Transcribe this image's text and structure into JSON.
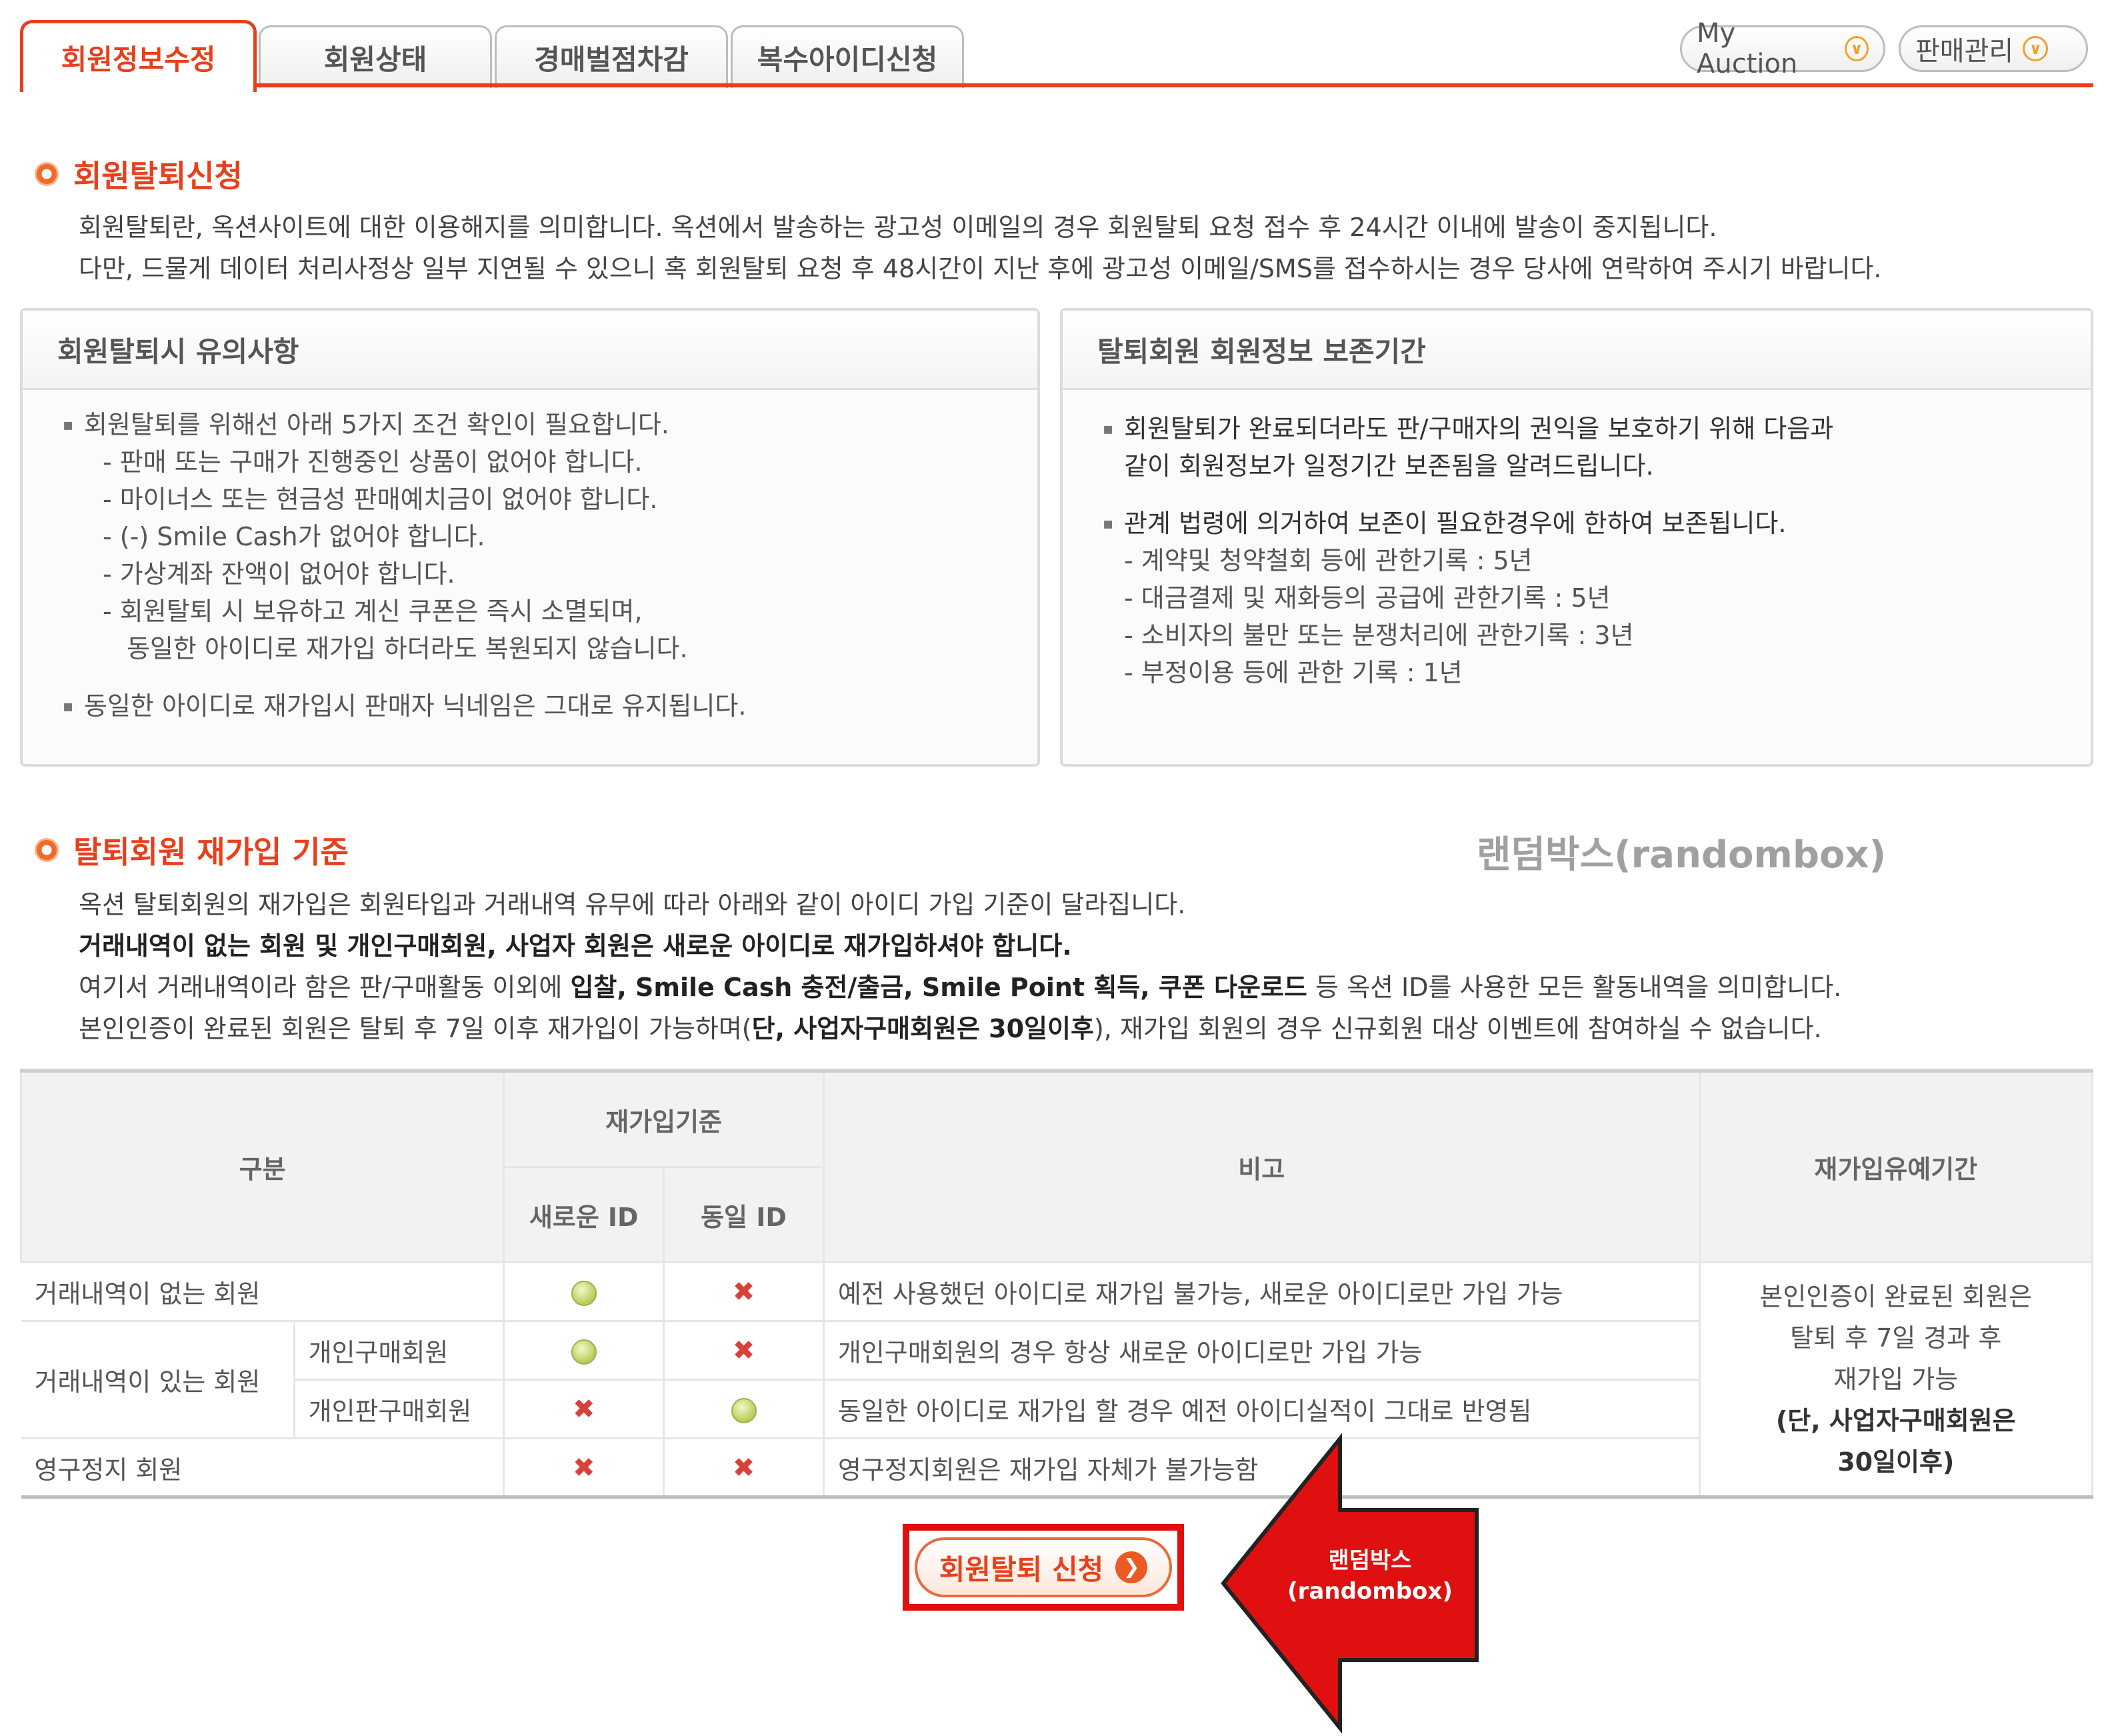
{
  "tabs": [
    "회원정보수정",
    "회원상태",
    "경매벌점차감",
    "복수아이디신청"
  ],
  "header_buttons": [
    "My Auction",
    "판매관리"
  ],
  "withdraw": {
    "title": "회원탈퇴신청",
    "line1": "회원탈퇴란, 옥션사이트에 대한 이용해지를 의미합니다. 옥션에서 발송하는 광고성 이메일의 경우 회원탈퇴 요청 접수 후 24시간 이내에 발송이 중지됩니다.",
    "line2": "다만, 드물게 데이터 처리사정상 일부 지연될 수 있으니 혹 회원탈퇴 요청 후 48시간이 지난 후에 광고성 이메일/SMS를 접수하시는 경우 당사에 연락하여 주시기 바랍니다."
  },
  "notice_box": {
    "title": "회원탈퇴시 유의사항",
    "items": [
      "회원탈퇴를 위해선 아래 5가지 조건 확인이 필요합니다.",
      "- 판매 또는 구매가 진행중인 상품이 없어야 합니다.",
      "- 마이너스 또는 현금성 판매예치금이 없어야 합니다.",
      "- (-) Smile Cash가 없어야 합니다.",
      "- 가상계좌 잔액이 없어야 합니다.",
      "- 회원탈퇴 시 보유하고 계신 쿠폰은 즉시 소멸되며,",
      "동일한 아이디로 재가입 하더라도 복원되지 않습니다.",
      "동일한 아이디로 재가입시 판매자 닉네임은 그대로 유지됩니다."
    ]
  },
  "retention_box": {
    "title": "탈퇴회원 회원정보 보존기간",
    "items": [
      "회원탈퇴가 완료되더라도 판/구매자의 권익을 보호하기 위해 다음과",
      "같이 회원정보가 일정기간 보존됨을 알려드립니다.",
      "관계 법령에 의거하여 보존이 필요한경우에 한하여 보존됩니다.",
      "- 계약및 청약철회 등에 관한기록 : 5년",
      "- 대금결제 및 재화등의 공급에 관한기록 : 5년",
      "- 소비자의 불만 또는 분쟁처리에 관한기록 : 3년",
      "- 부정이용 등에 관한 기록 : 1년"
    ]
  },
  "rejoin": {
    "title": "탈퇴회원 재가입 기준",
    "line1": "옥션 탈퇴회원의 재가입은 회원타입과 거래내역 유무에 따라 아래와 같이 아이디 가입 기준이 달라집니다.",
    "line2": "거래내역이 없는 회원 및 개인구매회원, 사업자 회원은 새로운 아이디로 재가입하셔야 합니다.",
    "line3_a": "여기서 거래내역이라 함은 판/구매활동 이외에 ",
    "line3_b": "입찰, Smile Cash 충전/출금, Smile Point 획득, 쿠폰 다운로드",
    "line3_c": " 등 옥션 ID를 사용한 모든 활동내역을 의미합니다.",
    "line4_a": "본인인증이 완료된 회원은 탈퇴 후 7일 이후 재가입이 가능하며(",
    "line4_b": "단, 사업자구매회원은 30일이후",
    "line4_c": "), 재가입 회원의 경우 신규회원 대상 이벤트에 참여하실 수 없습니다."
  },
  "watermark": "랜덤박스(randombox)",
  "table": {
    "headers": {
      "category": "구분",
      "rejoin_basis": "재가입기준",
      "new_id": "새로운 ID",
      "same_id": "동일 ID",
      "note": "비고",
      "grace": "재가입유예기간"
    },
    "rows": [
      {
        "cat": "거래내역이 없는 회원",
        "sub": "",
        "new_id": "ok",
        "same_id": "no",
        "note": "예전 사용했던 아이디로 재가입 불가능, 새로운 아이디로만 가입 가능"
      },
      {
        "cat": "거래내역이 있는 회원",
        "sub": "개인구매회원",
        "new_id": "ok",
        "same_id": "no",
        "note": "개인구매회원의 경우 항상 새로운 아이디로만 가입 가능"
      },
      {
        "cat": "",
        "sub": "개인판구매회원",
        "new_id": "no",
        "same_id": "ok",
        "note": "동일한 아이디로 재가입 할 경우 예전 아이디실적이 그대로 반영됨"
      },
      {
        "cat": "영구정지 회원",
        "sub": "",
        "new_id": "no",
        "same_id": "no",
        "note": "영구정지회원은 재가입 자체가 불가능함"
      }
    ],
    "grace_text": [
      "본인인증이 완료된 회원은",
      "탈퇴 후 7일 경과 후",
      "재가입 가능",
      "(단, 사업자구매회원은",
      "30일이후)"
    ]
  },
  "button": {
    "label": "회원탈퇴 신청"
  },
  "annotation": {
    "line1": "랜덤박스",
    "line2": "(randombox)"
  },
  "colors": {
    "accent": "#e8401c",
    "annotation_red": "#e01010"
  }
}
